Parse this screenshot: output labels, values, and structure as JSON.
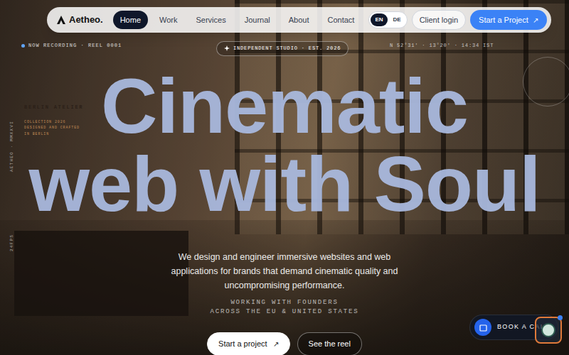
{
  "nav": {
    "logo": "Aetheo.",
    "links": [
      {
        "label": "Home",
        "selected": true
      },
      {
        "label": "Work",
        "selected": false
      },
      {
        "label": "Services",
        "selected": false
      },
      {
        "label": "Journal",
        "selected": false
      },
      {
        "label": "About",
        "selected": false
      },
      {
        "label": "Contact",
        "selected": false
      }
    ],
    "languages": [
      {
        "label": "EN",
        "selected": true
      },
      {
        "label": "DE",
        "selected": false
      }
    ],
    "client_login": "Client login",
    "cta": {
      "label": "Start a Project",
      "icon": "↗"
    }
  },
  "hero": {
    "status": "NOW RECORDING · REEL 0001",
    "badge": "INDEPENDENT STUDIO · EST. 2026",
    "coordinates": "N 52°31′ · 13°20′ · 14:34 IST",
    "atelier": {
      "title": "BERLIN ATELIER",
      "lines": [
        "COLLECTION 2026",
        "DESIGNED AND CRAFTED",
        "IN BERLIN"
      ]
    },
    "side_label": "AETHEO · MMXXVI",
    "fps": "24FPS",
    "headline": [
      "Cinematic",
      "web with Soul"
    ],
    "description": "We design and engineer immersive websites and web applications for brands that demand cinematic quality and uncompromising performance.",
    "tagline": [
      "WORKING WITH FOUNDERS",
      "ACROSS THE EU & UNITED STATES"
    ],
    "buttons": [
      {
        "label": "Start a project",
        "icon": "↗",
        "kind": "primary"
      },
      {
        "label": "See the reel",
        "icon": "",
        "kind": "secondary"
      }
    ]
  },
  "widgets": {
    "book_call": "BOOK A CALL"
  }
}
